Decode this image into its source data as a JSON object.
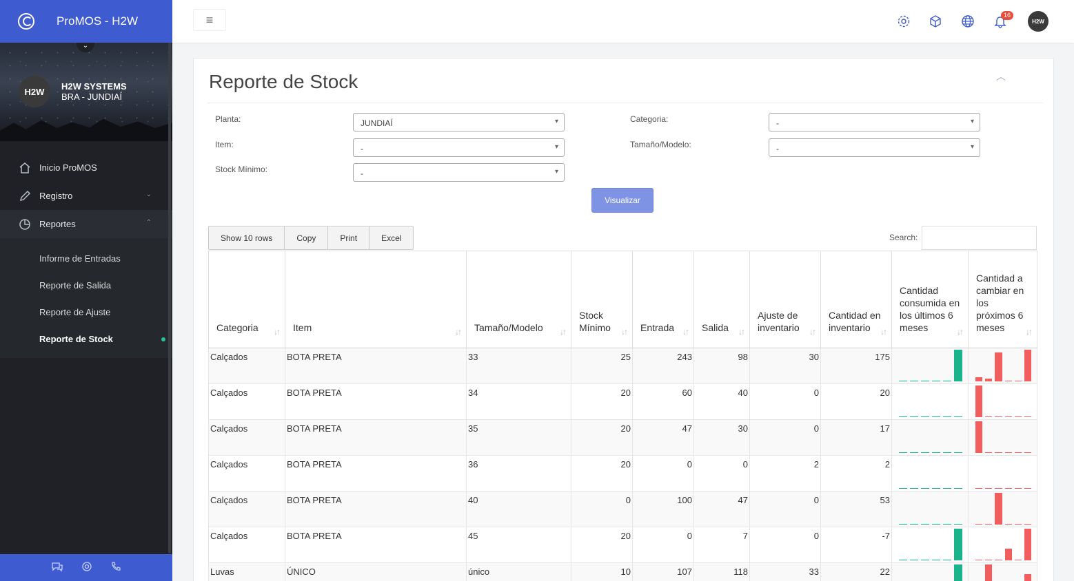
{
  "app": {
    "title": "ProMOS - H2W"
  },
  "profile": {
    "initials": "H2W",
    "name": "H2W SYSTEMS",
    "location": "BRA - JUNDIAÍ"
  },
  "nav": [
    {
      "label": "Inicio ProMOS",
      "icon": "home-icon"
    },
    {
      "label": "Registro",
      "icon": "pencil-icon"
    },
    {
      "label": "Reportes",
      "icon": "pie-chart-icon"
    }
  ],
  "subnav": [
    {
      "label": "Informe de Entradas"
    },
    {
      "label": "Reporte de Salida"
    },
    {
      "label": "Reporte de Ajuste"
    },
    {
      "label": "Reporte de Stock"
    }
  ],
  "topbar": {
    "notifications": "16",
    "avatar": "H2W"
  },
  "page": {
    "title": "Reporte de Stock"
  },
  "filters": {
    "planta": {
      "label": "Planta:",
      "value": "JUNDIAÍ"
    },
    "categoria": {
      "label": "Categoria:",
      "value": "-"
    },
    "item": {
      "label": "Item:",
      "value": "-"
    },
    "tamano": {
      "label": "Tamaño/Modelo:",
      "value": "-"
    },
    "stock_min": {
      "label": "Stock Mínimo:",
      "value": "-"
    },
    "submit": "Visualizar"
  },
  "toolbar": {
    "show": "Show 10 rows",
    "copy": "Copy",
    "print": "Print",
    "excel": "Excel",
    "search_label": "Search:"
  },
  "columns": [
    "Categoria",
    "Item",
    "Tamaño/Modelo",
    "Stock Mínimo",
    "Entrada",
    "Salida",
    "Ajuste de inventario",
    "Cantidad en inventario",
    "Cantidad consumida en los últimos 6 meses",
    "Cantidad a cambiar en los próximos 6 meses"
  ],
  "rows": [
    {
      "categoria": "Calçados",
      "item": "BOTA PRETA",
      "tamano": "33",
      "stock_min": "25",
      "entrada": "243",
      "salida": "98",
      "ajuste": "30",
      "inventario": "175",
      "consumed": [
        0,
        0,
        0,
        0,
        0,
        1
      ],
      "to_change": [
        0.12,
        0.08,
        0.92,
        0,
        0,
        1
      ]
    },
    {
      "categoria": "Calçados",
      "item": "BOTA PRETA",
      "tamano": "34",
      "stock_min": "20",
      "entrada": "60",
      "salida": "40",
      "ajuste": "0",
      "inventario": "20",
      "consumed": [
        0,
        0,
        0,
        0,
        0,
        0
      ],
      "to_change": [
        1,
        0,
        0,
        0,
        0,
        0
      ]
    },
    {
      "categoria": "Calçados",
      "item": "BOTA PRETA",
      "tamano": "35",
      "stock_min": "20",
      "entrada": "47",
      "salida": "30",
      "ajuste": "0",
      "inventario": "17",
      "consumed": [
        0,
        0,
        0,
        0,
        0,
        0
      ],
      "to_change": [
        1,
        0,
        0,
        0,
        0,
        0
      ]
    },
    {
      "categoria": "Calçados",
      "item": "BOTA PRETA",
      "tamano": "36",
      "stock_min": "20",
      "entrada": "0",
      "salida": "0",
      "ajuste": "2",
      "inventario": "2",
      "consumed": [
        0,
        0,
        0,
        0,
        0,
        0
      ],
      "to_change": [
        0,
        0,
        0,
        0,
        0,
        0
      ]
    },
    {
      "categoria": "Calçados",
      "item": "BOTA PRETA",
      "tamano": "40",
      "stock_min": "0",
      "entrada": "100",
      "salida": "47",
      "ajuste": "0",
      "inventario": "53",
      "consumed": [
        0,
        0,
        0,
        0,
        0,
        0
      ],
      "to_change": [
        0,
        0,
        1,
        0,
        0,
        0
      ]
    },
    {
      "categoria": "Calçados",
      "item": "BOTA PRETA",
      "tamano": "45",
      "stock_min": "20",
      "entrada": "0",
      "salida": "7",
      "ajuste": "0",
      "inventario": "-7",
      "consumed": [
        0,
        0,
        0,
        0,
        0,
        1
      ],
      "to_change": [
        0,
        0,
        0,
        0.38,
        0,
        1
      ]
    },
    {
      "categoria": "Luvas",
      "item": "ÚNICO",
      "tamano": "único",
      "stock_min": "10",
      "entrada": "107",
      "salida": "118",
      "ajuste": "33",
      "inventario": "22",
      "consumed": [
        0,
        0,
        0,
        0,
        0,
        1
      ],
      "to_change": [
        0,
        1,
        0,
        0,
        0,
        0.7
      ]
    }
  ]
}
